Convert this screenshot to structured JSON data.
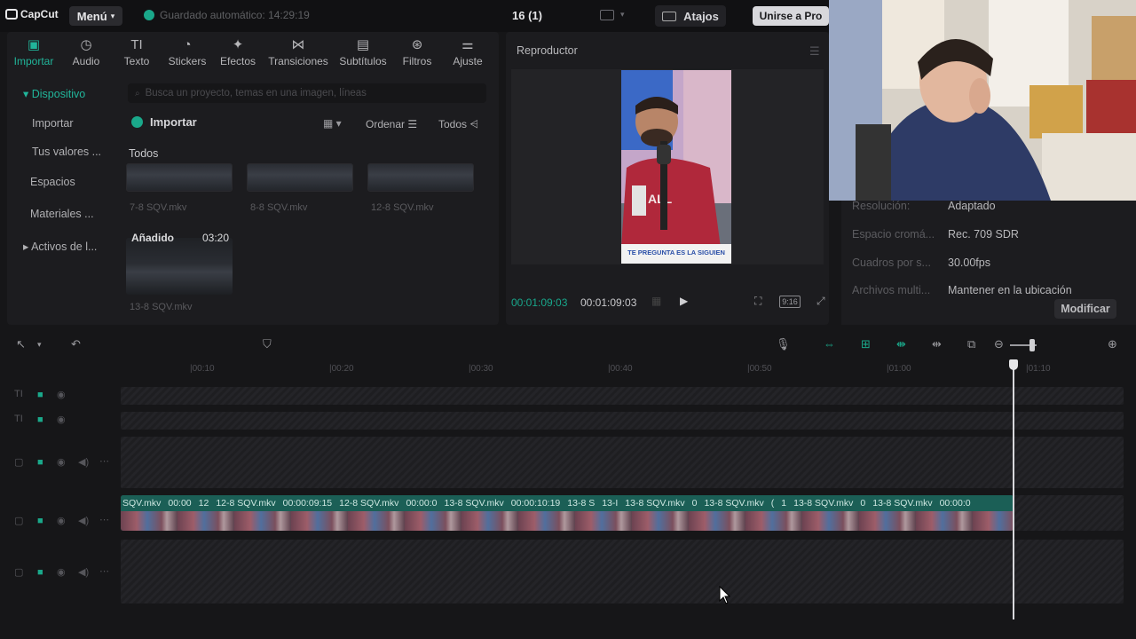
{
  "app": {
    "logo": "CapCut",
    "menu": "Menú",
    "autosave": "Guardado automático: 14:29:19",
    "project_title": "16 (1)",
    "shortcuts": "Atajos",
    "pro": "Unirse a Pro"
  },
  "tabs": [
    {
      "label": "Importar",
      "icon": "import-icon"
    },
    {
      "label": "Audio",
      "icon": "audio-icon"
    },
    {
      "label": "Texto",
      "icon": "text-icon"
    },
    {
      "label": "Stickers",
      "icon": "stickers-icon"
    },
    {
      "label": "Efectos",
      "icon": "effects-icon"
    },
    {
      "label": "Transiciones",
      "icon": "transitions-icon"
    },
    {
      "label": "Subtítulos",
      "icon": "subtitles-icon"
    },
    {
      "label": "Filtros",
      "icon": "filters-icon"
    },
    {
      "label": "Ajuste",
      "icon": "adjust-icon"
    }
  ],
  "sidebar": [
    "Dispositivo",
    "Importar",
    "Tus valores ...",
    "Espacios",
    "Materiales ...",
    "Activos de l..."
  ],
  "media": {
    "search_placeholder": "Busca un proyecto, temas en una imagen, líneas",
    "import": "Importar",
    "order": "Ordenar",
    "filter": "Todos",
    "section_all": "Todos",
    "clips": [
      "7-8 SQV.mkv",
      "8-8 SQV.mkv",
      "12-8 SQV.mkv"
    ],
    "added_label": "Añadido",
    "added_duration": "03:20",
    "added_clip": "13-8 SQV.mkv"
  },
  "player": {
    "title": "Reproductor",
    "current_time": "00:01:09:03",
    "total_time": "00:01:09:03",
    "ratio": "9:16",
    "caption": "TE PREGUNTA ES LA SIGUIEN"
  },
  "details": {
    "rows": [
      {
        "label": "Resolución:",
        "value": "Adaptado"
      },
      {
        "label": "Espacio cromá...",
        "value": "Rec. 709 SDR"
      },
      {
        "label": "Cuadros por s...",
        "value": "30.00fps"
      },
      {
        "label": "Archivos multi...",
        "value": "Mantener en la ubicación"
      }
    ],
    "modify": "Modificar"
  },
  "timeline": {
    "ruler": [
      "|00:10",
      "|00:20",
      "|00:30",
      "|00:40",
      "|00:50",
      "|01:00",
      "|01:10"
    ],
    "clip_labels": [
      "SQV.mkv",
      "00:00",
      "12",
      "12-8 SQV.mkv",
      "00:00:09:15",
      "12-8 SQV.mkv",
      "00:00:0",
      "13-8 SQV.mkv",
      "00:00:10:19",
      "13-8 S",
      "13-I",
      "13-8 SQV.mkv",
      "0",
      "13-8 SQV.mkv",
      "(",
      "1",
      "13-8 SQV.mkv",
      "0",
      "13-8 SQV.mkv",
      "00:00:0"
    ]
  },
  "colors": {
    "accent": "#1aa88a",
    "bg": "#161618",
    "panel": "#1c1c1f"
  }
}
